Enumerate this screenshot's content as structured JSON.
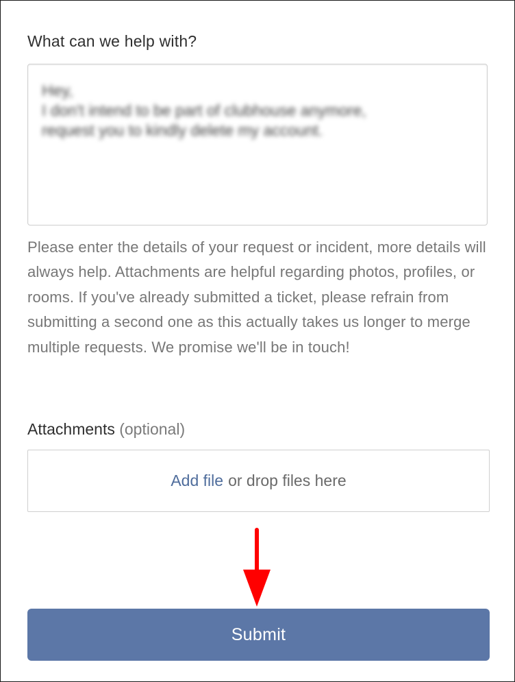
{
  "form": {
    "description_label": "What can we help with?",
    "description_value": "Hey,\nI don't intend to be part of clubhouse anymore,\nrequest you to kindly delete my account.",
    "help_text": "Please enter the details of your request or incident, more details will always help. Attachments are helpful regarding photos, profiles, or rooms. If you've already submitted a ticket, please refrain from submitting a second one as this actually takes us longer to merge multiple requests. We promise we'll be in touch!",
    "attachments_label": "Attachments",
    "attachments_optional": "(optional)",
    "add_file_link": "Add file",
    "drop_text": "or drop files here",
    "submit_label": "Submit"
  },
  "colors": {
    "accent": "#5c77a7",
    "link": "#4f6d9c",
    "annotation_arrow": "#ff0000"
  },
  "icons": {
    "annotation": "red-down-arrow-icon"
  }
}
